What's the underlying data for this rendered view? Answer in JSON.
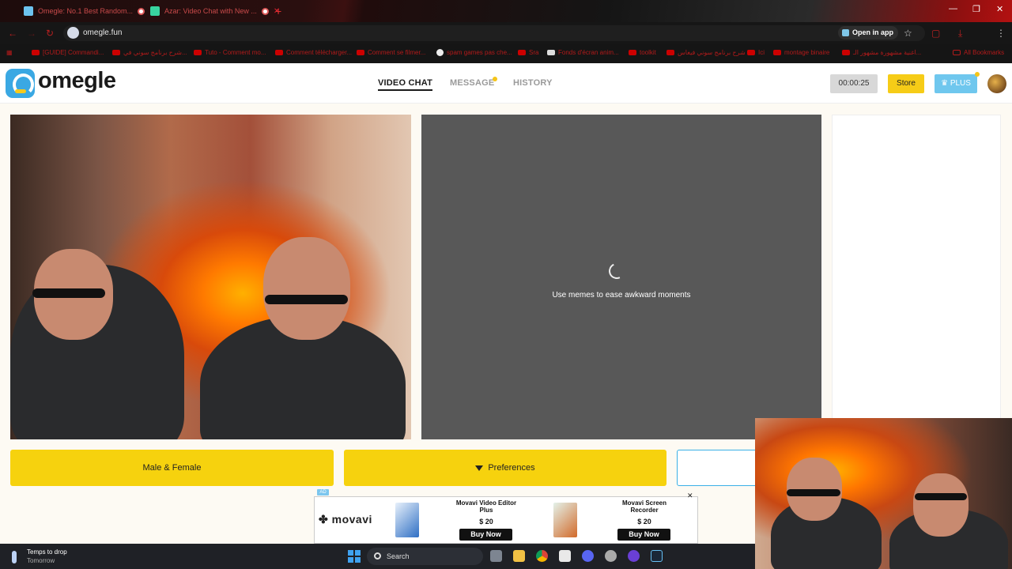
{
  "browser": {
    "tabs": [
      {
        "label": "Omegle: No.1 Best Random..."
      },
      {
        "label": "Azar: Video Chat with New ..."
      }
    ],
    "new_tab_icon": "plus-icon",
    "url": "omegle.fun",
    "open_in_app": "Open in app",
    "bookmarks": [
      "[GUIDE] Commandi...",
      "شرح برنامج سوني في...",
      "Tuto - Comment mo...",
      "Comment télécharger...",
      "Comment se filmer...",
      "spam games pas che...",
      "Sra",
      "Fonds d'écran anim...",
      "toolkit",
      "شرح برنامج سوني فيغاس",
      "Ici",
      "montage binaire",
      "اغنية مشهورة مشهور الـ...",
      "All Bookmarks"
    ]
  },
  "site": {
    "logo_text": "omegle",
    "nav": {
      "video_chat": "VIDEO CHAT",
      "message": "MESSAGE",
      "history": "HISTORY"
    },
    "timer": "00:00:25",
    "store": "Store",
    "plus": "PLUS",
    "accent_color": "#f6d20e",
    "plus_color": "#6fc7ee"
  },
  "chat": {
    "waiting_caption": "Use memes to ease awkward moments",
    "gender_button": "Male & Female",
    "preferences_button": "Preferences"
  },
  "ad": {
    "tag": "AD",
    "brand": "movavi",
    "products": [
      {
        "title": "Movavi Video Editor Plus",
        "price": "$ 20",
        "cta": "Buy Now"
      },
      {
        "title": "Movavi Screen Recorder",
        "price": "$ 20",
        "cta": "Buy Now"
      }
    ]
  },
  "taskbar": {
    "weather_title": "Temps to drop",
    "weather_sub": "Tomorrow",
    "search_placeholder": "Search"
  }
}
